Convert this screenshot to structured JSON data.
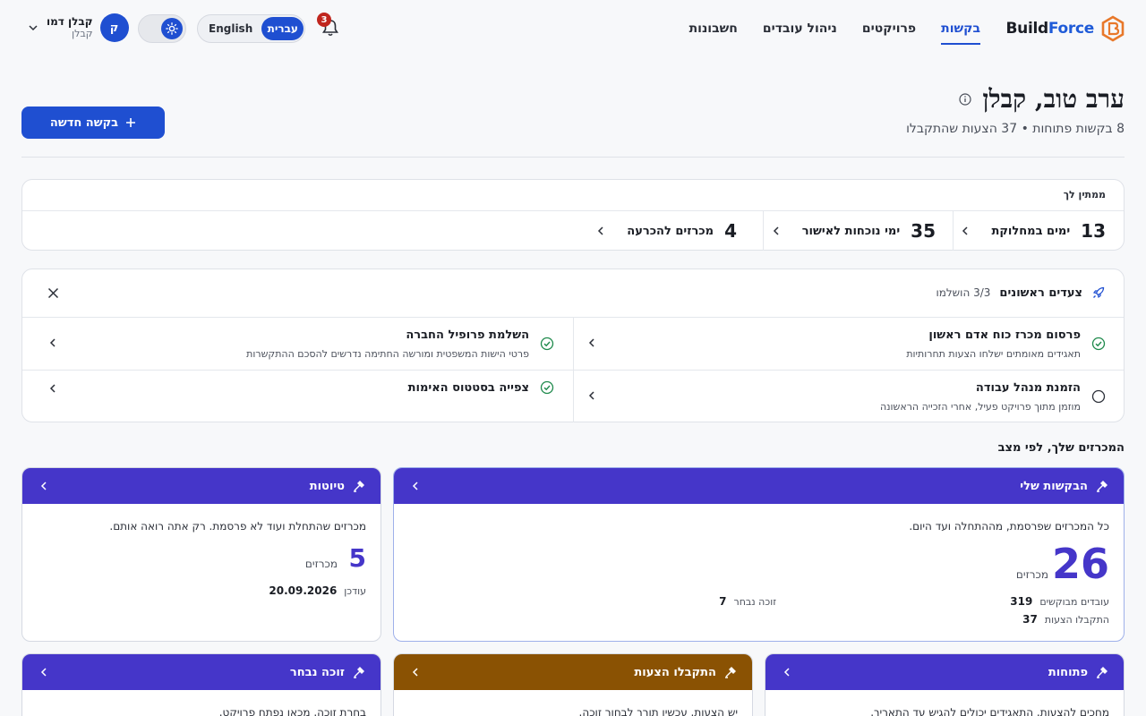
{
  "brand": {
    "part1": "Build",
    "part2": "Force"
  },
  "nav": [
    {
      "label": "בקשות",
      "active": true
    },
    {
      "label": "פרויקטים",
      "active": false
    },
    {
      "label": "ניהול עובדים",
      "active": false
    },
    {
      "label": "חשבונות",
      "active": false
    }
  ],
  "notifications": {
    "count": "3"
  },
  "language": {
    "en": "English",
    "he": "עברית",
    "selected": "he"
  },
  "user": {
    "name": "קבלן דמו",
    "role": "קבלן",
    "initial": "ק"
  },
  "greeting": {
    "title": "ערב טוב, קבלן",
    "subtitle": "8 בקשות פתוחות • 37 הצעות שהתקבלו",
    "new_request": "בקשה חדשה"
  },
  "waiting": {
    "title": "ממתין לך",
    "stats": [
      {
        "num": "13",
        "label": "ימים במחלוקת"
      },
      {
        "num": "35",
        "label": "ימי נוכחות לאישור"
      },
      {
        "num": "4",
        "label": "מכרזים להכרעה"
      }
    ]
  },
  "first_steps": {
    "title": "צעדים ראשונים",
    "progress": "3/3 הושלמו",
    "items": [
      {
        "title": "פרסום מכרז כוח אדם ראשון",
        "desc": "תאגידים מאומתים ישלחו הצעות תחרותיות",
        "done": true
      },
      {
        "title": "השלמת פרופיל החברה",
        "desc": "פרטי הישות המשפטית ומורשה החתימה נדרשים להסכם ההתקשרות",
        "done": true
      },
      {
        "title": "הזמנת מנהל עבודה",
        "desc": "מוזמן מתוך פרויקט פעיל, אחרי הזכייה הראשונה",
        "done": false
      },
      {
        "title": "צפייה בסטטוס האימות",
        "desc": "",
        "done": true
      }
    ]
  },
  "tenders_section": {
    "title": "המכרזים שלך, לפי מצב"
  },
  "cards": {
    "my_requests": {
      "title": "הבקשות שלי",
      "desc": "כל המכרזים שפרסמת, מההתחלה ועד היום.",
      "count": "26",
      "count_label": "מכרזים",
      "workers_label": "עובדים מבוקשים",
      "workers_value": "319",
      "offers_label": "התקבלו הצעות",
      "offers_value": "37",
      "winner_label": "זוכה נבחר",
      "winner_value": "7"
    },
    "drafts": {
      "title": "טיוטות",
      "desc": "מכרזים שהתחלת ועוד לא פרסמת. רק אתה רואה אותם.",
      "count": "5",
      "count_label": "מכרזים",
      "updated_label": "עודכן",
      "updated_value": "20.09.2026"
    },
    "open": {
      "title": "פתוחות",
      "desc": "מחכים להצעות. התאגידים יכולים להגיש עד התאריך."
    },
    "offers_received": {
      "title": "התקבלו הצעות",
      "desc": "יש הצעות. עכשיו תורך לבחור זוכה."
    },
    "winner_chosen": {
      "title": "זוכה נבחר",
      "desc": "בחרת זוכה. מכאן נפתח פרויקט."
    }
  },
  "colors": {
    "primary": "#1f4fd1",
    "violet": "#4536c9",
    "brown": "#8a5203",
    "badge": "#c0261e",
    "success": "#1f8a4c"
  }
}
